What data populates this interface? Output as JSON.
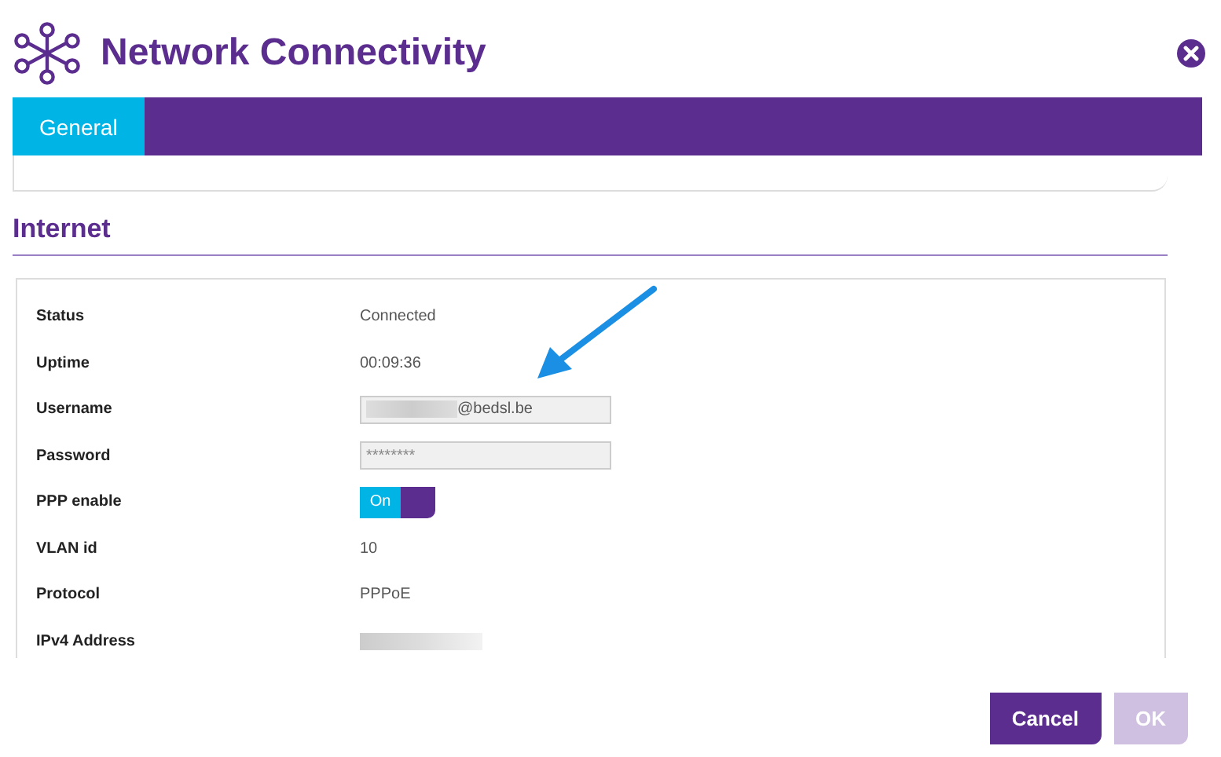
{
  "window": {
    "title": "Network Connectivity"
  },
  "tabs": [
    {
      "label": "General",
      "selected": true
    }
  ],
  "section": {
    "title": "Internet"
  },
  "rows": [
    {
      "label": "Status",
      "kind": "text",
      "value": "Connected"
    },
    {
      "label": "Uptime",
      "kind": "text",
      "value": "00:09:36"
    },
    {
      "label": "Username",
      "kind": "field",
      "value": "@bedsl.be",
      "redacted": true
    },
    {
      "label": "Password",
      "kind": "field",
      "value": "********"
    },
    {
      "label": "PPP enable",
      "kind": "toggle",
      "on": true,
      "value": "On"
    },
    {
      "label": "VLAN id",
      "kind": "text",
      "value": "10"
    },
    {
      "label": "Protocol",
      "kind": "text",
      "value": "PPPoE"
    },
    {
      "label": "IPv4 Address",
      "kind": "hidden"
    }
  ],
  "buttons": [
    {
      "label": "Cancel",
      "disabled": false
    },
    {
      "label": "OK",
      "disabled": true
    }
  ]
}
